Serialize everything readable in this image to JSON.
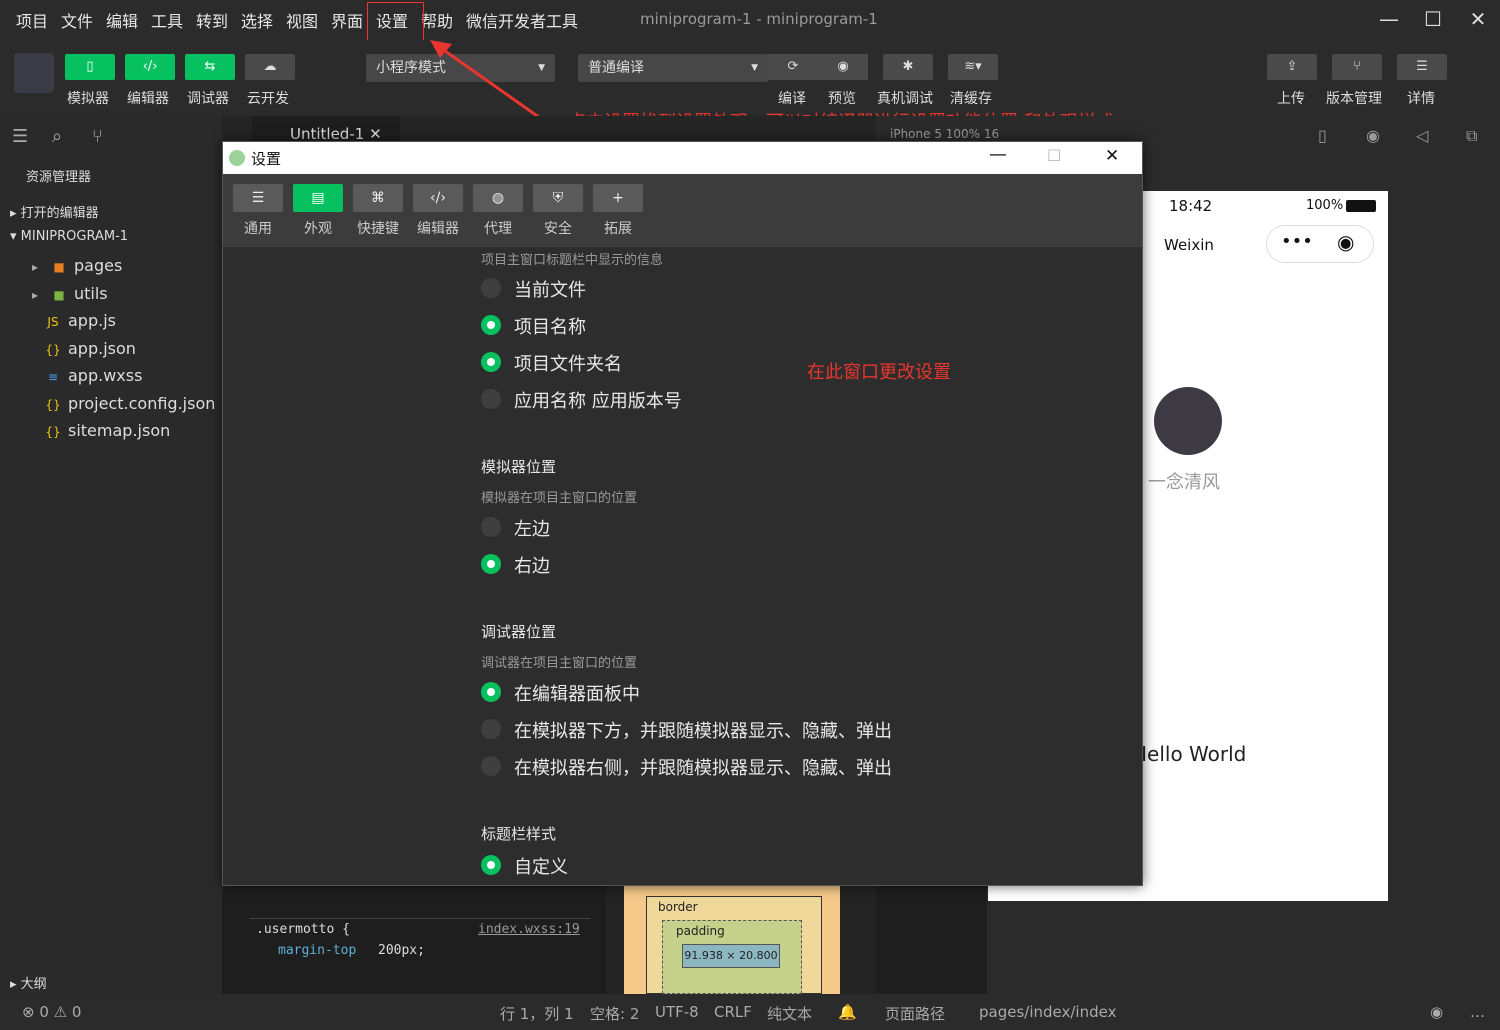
{
  "menu": [
    "项目",
    "文件",
    "编辑",
    "工具",
    "转到",
    "选择",
    "视图",
    "界面",
    "设置",
    "帮助",
    "微信开发者工具"
  ],
  "window_title": "miniprogram-1 - miniprogram-1",
  "toolbar": {
    "left_labels": [
      "模拟器",
      "编辑器",
      "调试器",
      "云开发"
    ],
    "mode_select": "小程序模式",
    "compile_select": "普通编译",
    "mid_labels": [
      "编译",
      "预览",
      "真机调试",
      "清缓存"
    ],
    "right_labels": [
      "上传",
      "版本管理",
      "详情"
    ]
  },
  "annotation_top": "点击设置找到设置外观，可以对编译器进行设置功能位置 和外观样式",
  "sidebar": {
    "title": "资源管理器",
    "open_editors": "打开的编辑器",
    "project": "MINIPROGRAM-1",
    "items": [
      "pages",
      "utils",
      "app.js",
      "app.json",
      "app.wxss",
      "project.config.json",
      "sitemap.json"
    ],
    "outline": "大纲"
  },
  "editor_tab": "Untitled-1",
  "sim_device": "iPhone 5 100% 16",
  "phone": {
    "time": "18:42",
    "battery": "100%",
    "nav_title": "Weixin",
    "username": "一念清风",
    "hello": "Hello World"
  },
  "dialog": {
    "title": "设置",
    "tabs": [
      "通用",
      "外观",
      "快捷键",
      "编辑器",
      "代理",
      "安全",
      "拓展"
    ],
    "section1_sub": "项目主窗口标题栏中显示的信息",
    "section1_opts": [
      "当前文件",
      "项目名称",
      "项目文件夹名",
      "应用名称 应用版本号"
    ],
    "section2_title": "模拟器位置",
    "section2_sub": "模拟器在项目主窗口的位置",
    "section2_opts": [
      "左边",
      "右边"
    ],
    "section3_title": "调试器位置",
    "section3_sub": "调试器在项目主窗口的位置",
    "section3_opts": [
      "在编辑器面板中",
      "在模拟器下方，并跟随模拟器显示、隐藏、弹出",
      "在模拟器右侧，并跟随模拟器显示、隐藏、弹出"
    ],
    "section4_title": "标题栏样式",
    "section4_opts": [
      "自定义"
    ],
    "note": "在此窗口更改设置"
  },
  "css": {
    "selector": ".usermotto {",
    "link": "index.wxss:19",
    "prop": "margin-top",
    "val": "200px;"
  },
  "boxmodel": {
    "border": "border",
    "padding": "padding",
    "size": "91.938 × 20.800",
    "dash": "–"
  },
  "status": {
    "errors": "⊗ 0 ⚠ 0",
    "pos": "行 1，列 1",
    "indent": "空格: 2",
    "enc": "UTF-8",
    "eol": "CRLF",
    "lang": "纯文本",
    "path_label": "页面路径",
    "path": "pages/index/index"
  }
}
